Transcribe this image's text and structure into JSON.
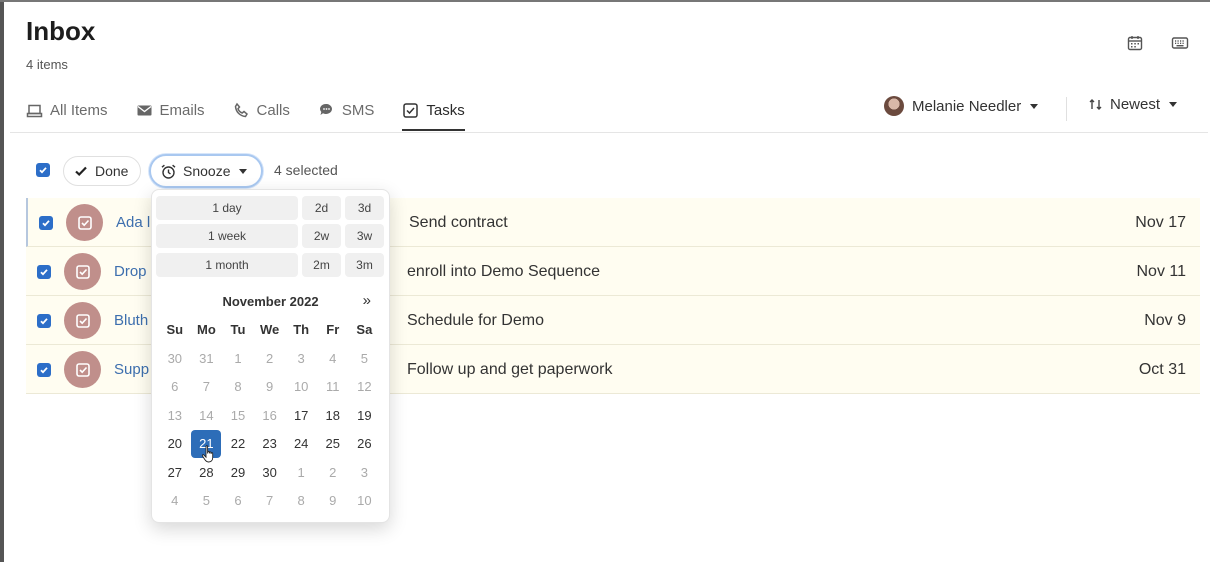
{
  "header": {
    "title": "Inbox",
    "count": "4 items"
  },
  "header_icons": [
    "calendar-icon",
    "keyboard-icon"
  ],
  "tabs": [
    {
      "label": "All Items",
      "icon": "inbox-tray-icon"
    },
    {
      "label": "Emails",
      "icon": "envelope-icon"
    },
    {
      "label": "Calls",
      "icon": "phone-icon"
    },
    {
      "label": "SMS",
      "icon": "chat-icon"
    },
    {
      "label": "Tasks",
      "icon": "checkbox-icon",
      "active": true
    }
  ],
  "owner": {
    "name": "Melanie Needler"
  },
  "sort": {
    "label": "Newest"
  },
  "toolbar": {
    "done_label": "Done",
    "snooze_label": "Snooze",
    "selected_text": "4 selected"
  },
  "rows": [
    {
      "name": "Ada l",
      "subject": "Send contract",
      "date": "Nov 17"
    },
    {
      "name": "Drop",
      "subject": "enroll into Demo Sequence",
      "date": "Nov 11"
    },
    {
      "name": "Bluth",
      "subject": "Schedule for Demo",
      "date": "Nov 9"
    },
    {
      "name": "Supp",
      "subject": "Follow up and get paperwork",
      "date": "Oct 31"
    }
  ],
  "snooze": {
    "quick": [
      [
        "1 day",
        "2d",
        "3d"
      ],
      [
        "1 week",
        "2w",
        "3w"
      ],
      [
        "1 month",
        "2m",
        "3m"
      ]
    ],
    "month_label": "November 2022",
    "next_label": "»",
    "weekdays": [
      "Su",
      "Mo",
      "Tu",
      "We",
      "Th",
      "Fr",
      "Sa"
    ],
    "weeks": [
      [
        "30",
        "31",
        "1",
        "2",
        "3",
        "4",
        "5"
      ],
      [
        "6",
        "7",
        "8",
        "9",
        "10",
        "11",
        "12"
      ],
      [
        "13",
        "14",
        "15",
        "16",
        "17",
        "18",
        "19"
      ],
      [
        "20",
        "21",
        "22",
        "23",
        "24",
        "25",
        "26"
      ],
      [
        "27",
        "28",
        "29",
        "30",
        "1",
        "2",
        "3"
      ],
      [
        "4",
        "5",
        "6",
        "7",
        "8",
        "9",
        "10"
      ]
    ],
    "selected_day": "21"
  },
  "colors": {
    "accent": "#2c6ec8",
    "row_bg": "#fffdf1",
    "task_icon_bg": "#c08f8b",
    "link": "#3d6fae"
  }
}
